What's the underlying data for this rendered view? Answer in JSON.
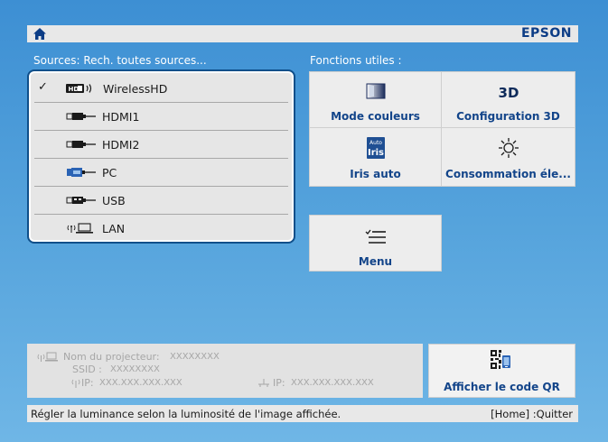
{
  "header": {
    "brand": "EPSON",
    "home_icon": "home-icon"
  },
  "sources": {
    "title": "Sources: Rech. toutes sources...",
    "selected": "WirelessHD",
    "items": [
      {
        "label": "WirelessHD",
        "icon": "wirelesshd-icon",
        "checked": true
      },
      {
        "label": "HDMI1",
        "icon": "hdmi-connector-icon",
        "checked": false
      },
      {
        "label": "HDMI2",
        "icon": "hdmi-connector-icon",
        "checked": false
      },
      {
        "label": "PC",
        "icon": "vga-connector-icon",
        "checked": false
      },
      {
        "label": "USB",
        "icon": "usb-connector-icon",
        "checked": false
      },
      {
        "label": "LAN",
        "icon": "lan-network-icon",
        "checked": false
      }
    ],
    "check_mark": "✓"
  },
  "functions": {
    "title": "Fonctions utiles  :",
    "tiles": [
      {
        "label": "Mode couleurs",
        "icon": "color-mode-icon"
      },
      {
        "label": "Configuration 3D",
        "icon": "3d-icon",
        "icon_text": "3D"
      },
      {
        "label": "Iris auto",
        "icon": "auto-iris-icon",
        "icon_text_top": "Auto",
        "icon_text_bottom": "Iris"
      },
      {
        "label": "Consommation éle...",
        "icon": "power-consumption-icon"
      },
      {
        "label": "Menu",
        "icon": "menu-list-icon"
      }
    ]
  },
  "network_info": {
    "projector_name_label": "Nom du projecteur:",
    "projector_name_value": "XXXXXXXX",
    "ssid_label": "SSID :",
    "ssid_value": "XXXXXXXX",
    "wireless_ip_label": "IP:",
    "wireless_ip_value": "XXX.XXX.XXX.XXX",
    "wired_ip_label": "IP:",
    "wired_ip_value": "XXX.XXX.XXX.XXX"
  },
  "qr": {
    "label": "Afficher le code QR",
    "icon": "qr-code-icon"
  },
  "status_bar": {
    "help_text": "Régler la luminance selon la luminosité de l'image affichée.",
    "quit_hint": "[Home] :Quitter"
  },
  "colors": {
    "background": "#4a9ad9",
    "tile_label": "#13458a",
    "brand": "#0d3d86",
    "panel_border": "#0f4f8a"
  }
}
